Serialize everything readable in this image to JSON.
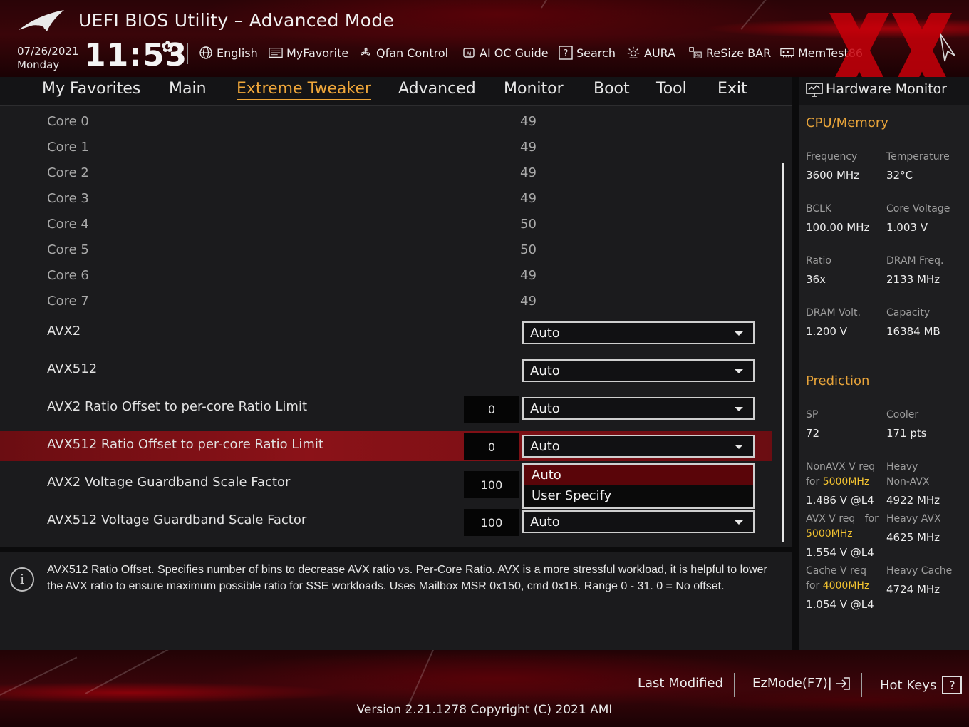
{
  "header": {
    "title": "UEFI BIOS Utility – Advanced Mode",
    "date": "07/26/2021",
    "day": "Monday",
    "time": "11:53",
    "tools": [
      {
        "label": "English",
        "icon": "globe-icon"
      },
      {
        "label": "MyFavorite",
        "icon": "favorite-icon"
      },
      {
        "label": "Qfan Control",
        "icon": "fan-icon"
      },
      {
        "label": "AI OC Guide",
        "icon": "ai-chip-icon"
      },
      {
        "label": "Search",
        "icon": "search-help-icon"
      },
      {
        "label": "AURA",
        "icon": "aura-light-icon"
      },
      {
        "label": "ReSize BAR",
        "icon": "resize-bar-icon"
      },
      {
        "label": "MemTest86",
        "icon": "memory-icon"
      }
    ]
  },
  "tabs": [
    "My Favorites",
    "Main",
    "Extreme Tweaker",
    "Advanced",
    "Monitor",
    "Boot",
    "Tool",
    "Exit"
  ],
  "active_tab": "Extreme Tweaker",
  "cores": [
    {
      "label": "Core 0",
      "value": "49"
    },
    {
      "label": "Core 1",
      "value": "49"
    },
    {
      "label": "Core 2",
      "value": "49"
    },
    {
      "label": "Core 3",
      "value": "49"
    },
    {
      "label": "Core 4",
      "value": "50"
    },
    {
      "label": "Core 5",
      "value": "50"
    },
    {
      "label": "Core 6",
      "value": "49"
    },
    {
      "label": "Core 7",
      "value": "49"
    }
  ],
  "settings": [
    {
      "label": "AVX2",
      "num": null,
      "select": "Auto"
    },
    {
      "label": "AVX512",
      "num": null,
      "select": "Auto"
    },
    {
      "label": "AVX2 Ratio Offset to per-core Ratio Limit",
      "num": "0",
      "select": "Auto"
    },
    {
      "label": "AVX512 Ratio Offset to per-core Ratio Limit",
      "num": "0",
      "select": "Auto"
    },
    {
      "label": "AVX2 Voltage Guardband Scale Factor",
      "num": "100",
      "select": null
    },
    {
      "label": "AVX512 Voltage Guardband Scale Factor",
      "num": "100",
      "select": "Auto"
    }
  ],
  "dropdown": {
    "options": [
      "Auto",
      "User Specify"
    ],
    "selected": "Auto"
  },
  "help": "AVX512 Ratio Offset. Specifies number of bins to decrease AVX ratio vs. Per-Core Ratio. AVX is a more stressful workload, it is helpful to lower the AVX ratio to ensure maximum possible ratio for SSE workloads. Uses Mailbox MSR 0x150, cmd 0x1B. Range 0 - 31. 0 = No offset.",
  "monitor": {
    "title": "Hardware Monitor",
    "cpu_title": "CPU/Memory",
    "cpu": [
      {
        "l1": "Frequency",
        "v1": "3600 MHz",
        "l2": "Temperature",
        "v2": "32°C"
      },
      {
        "l1": "BCLK",
        "v1": "100.00 MHz",
        "l2": "Core Voltage",
        "v2": "1.003 V"
      },
      {
        "l1": "Ratio",
        "v1": "36x",
        "l2": "DRAM Freq.",
        "v2": "2133 MHz"
      },
      {
        "l1": "DRAM Volt.",
        "v1": "1.200 V",
        "l2": "Capacity",
        "v2": "16384 MB"
      }
    ],
    "pred_title": "Prediction",
    "sp_label": "SP",
    "sp_value": "72",
    "cooler_label": "Cooler",
    "cooler_value": "171 pts",
    "nonavx_label": "NonAVX V req",
    "nonavx_for": "for",
    "nonavx_freq": "5000MHz",
    "nonavx_value": "1.486 V @L4",
    "heavy_nonavx_l1": "Heavy",
    "heavy_nonavx_l2": "Non-AVX",
    "heavy_nonavx_value": "4922 MHz",
    "avx_label": "AVX V req",
    "avx_for": "for",
    "avx_freq": "5000MHz",
    "avx_value": "1.554 V @L4",
    "heavy_avx_label": "Heavy AVX",
    "heavy_avx_value": "4625 MHz",
    "cache_label": "Cache V req",
    "cache_for": "for",
    "cache_freq": "4000MHz",
    "cache_value": "1.054 V @L4",
    "heavy_cache_label": "Heavy Cache",
    "heavy_cache_value": "4724 MHz"
  },
  "footer": {
    "last_modified": "Last Modified",
    "ezmode": "EzMode(F7)|",
    "hotkeys": "Hot Keys",
    "hotkeys_key": "?",
    "version": "Version 2.21.1278 Copyright (C) 2021 AMI"
  },
  "colors": {
    "accent": "#f0a73a",
    "highlight": "#8b1218",
    "brand_red": "#c8000a",
    "hw_highlight": "#f2c230"
  }
}
